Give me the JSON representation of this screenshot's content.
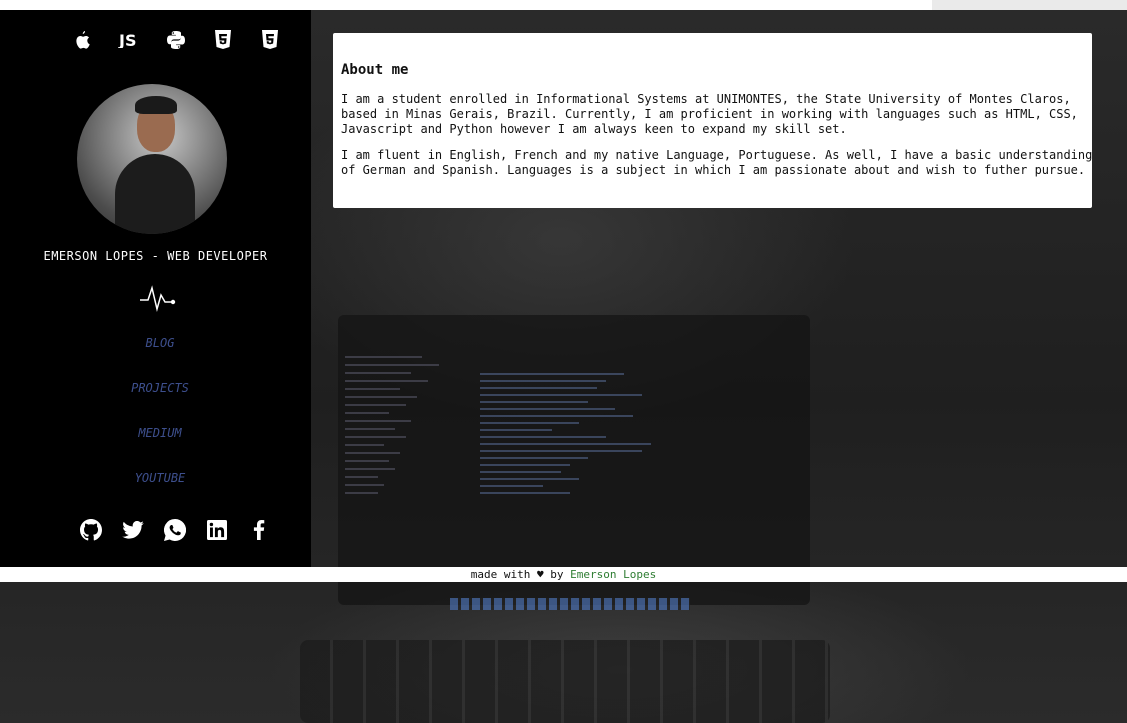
{
  "sidebar": {
    "tech_icons": [
      "apple-icon",
      "js-icon",
      "python-icon",
      "html5-icon",
      "css3-icon"
    ],
    "profile_name": "EMERSON LOPES - WEB DEVELOPER",
    "nav": [
      "BLOG",
      "PROJECTS",
      "MEDIUM",
      "YOUTUBE"
    ],
    "social_icons": [
      "github-icon",
      "twitter-icon",
      "whatsapp-icon",
      "linkedin-icon",
      "facebook-icon"
    ]
  },
  "about": {
    "title": "About me",
    "paragraph1": "I am a student enrolled in Informational Systems at UNIMONTES, the State University of Montes Claros, based in Minas Gerais, Brazil. Currently, I am proficient in working with languages such as HTML, CSS, Javascript and Python however I am always keen to expand my skill set.",
    "paragraph2": "I am fluent in English, French and my native Language, Portuguese. As well, I have a basic understanding of German and Spanish. Languages is a subject in which I am passionate about and wish to futher pursue."
  },
  "footer": {
    "prefix": "made with",
    "heart": "♥",
    "by": "by",
    "author": "Emerson Lopes"
  },
  "colors": {
    "sidebar_bg": "#000000",
    "nav_link": "#3d4f8d",
    "footer_author": "#2e7d32"
  }
}
